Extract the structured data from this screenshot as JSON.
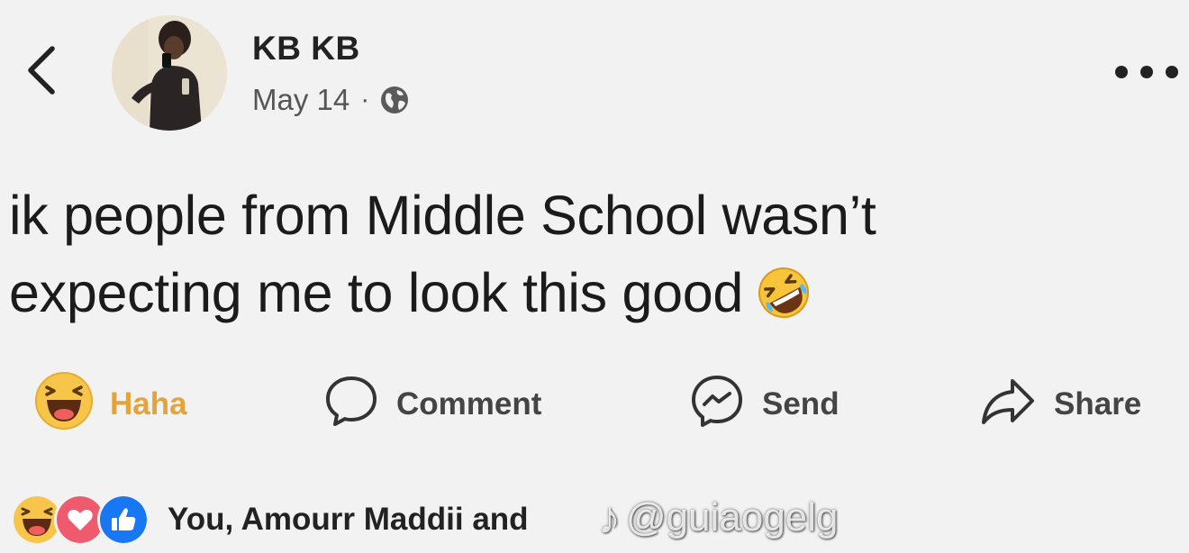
{
  "header": {
    "author_name": "KB KB",
    "date": "May 14",
    "separator": "·",
    "privacy_icon": "globe-icon",
    "back_icon": "chevron-left-icon",
    "more_icon": "more-horizontal-icon"
  },
  "post": {
    "line1": "ik people from Middle School wasn’t",
    "line2": "expecting me to look this good",
    "emoji": "rolling-on-floor-laughing-emoji"
  },
  "actions": {
    "haha_label": "Haha",
    "comment_label": "Comment",
    "send_label": "Send",
    "share_label": "Share"
  },
  "reactions": {
    "icons": [
      "haha-icon",
      "love-icon",
      "like-icon"
    ],
    "summary": "You, Amourr Maddii and"
  },
  "watermark": {
    "symbol": "♪",
    "handle": "@guiaogelg"
  },
  "colors": {
    "background": "#f2f2f2",
    "haha_accent": "#e2a43b",
    "love": "#f05a6e",
    "like": "#1877f2"
  }
}
